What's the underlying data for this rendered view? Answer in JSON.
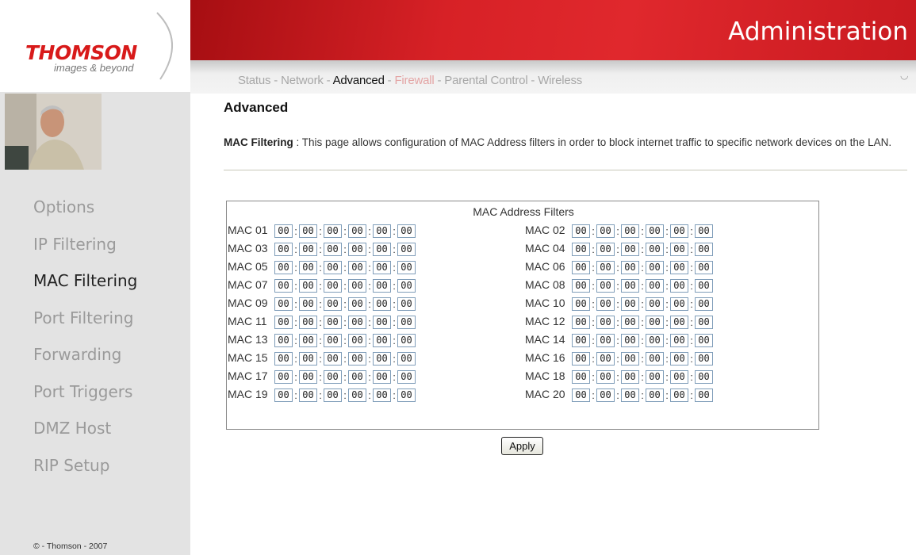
{
  "brand": {
    "name": "THOMSON",
    "tagline": "images & beyond"
  },
  "header": {
    "title": "Administration"
  },
  "topnav": [
    {
      "label": "Status",
      "state": "normal"
    },
    {
      "label": "Network",
      "state": "normal"
    },
    {
      "label": "Advanced",
      "state": "current"
    },
    {
      "label": "Firewall",
      "state": "highlight"
    },
    {
      "label": "Parental Control",
      "state": "normal"
    },
    {
      "label": "Wireless",
      "state": "normal"
    }
  ],
  "topnav_separator": " - ",
  "sidebar": {
    "items": [
      {
        "label": "Options",
        "active": false
      },
      {
        "label": "IP Filtering",
        "active": false
      },
      {
        "label": "MAC Filtering",
        "active": true
      },
      {
        "label": "Port Filtering",
        "active": false
      },
      {
        "label": "Forwarding",
        "active": false
      },
      {
        "label": "Port Triggers",
        "active": false
      },
      {
        "label": "DMZ Host",
        "active": false
      },
      {
        "label": "RIP Setup",
        "active": false
      }
    ],
    "copyright": "© - Thomson - 2007"
  },
  "main": {
    "title": "Advanced",
    "description_label": "MAC Filtering",
    "description_sep": " : ",
    "description": "This page allows configuration of MAC Address filters in order to block internet traffic to specific network devices on the LAN.",
    "filters_caption": "MAC Address Filters",
    "mac_entries": [
      {
        "label": "MAC 01",
        "octets": [
          "00",
          "00",
          "00",
          "00",
          "00",
          "00"
        ]
      },
      {
        "label": "MAC 02",
        "octets": [
          "00",
          "00",
          "00",
          "00",
          "00",
          "00"
        ]
      },
      {
        "label": "MAC 03",
        "octets": [
          "00",
          "00",
          "00",
          "00",
          "00",
          "00"
        ]
      },
      {
        "label": "MAC 04",
        "octets": [
          "00",
          "00",
          "00",
          "00",
          "00",
          "00"
        ]
      },
      {
        "label": "MAC 05",
        "octets": [
          "00",
          "00",
          "00",
          "00",
          "00",
          "00"
        ]
      },
      {
        "label": "MAC 06",
        "octets": [
          "00",
          "00",
          "00",
          "00",
          "00",
          "00"
        ]
      },
      {
        "label": "MAC 07",
        "octets": [
          "00",
          "00",
          "00",
          "00",
          "00",
          "00"
        ]
      },
      {
        "label": "MAC 08",
        "octets": [
          "00",
          "00",
          "00",
          "00",
          "00",
          "00"
        ]
      },
      {
        "label": "MAC 09",
        "octets": [
          "00",
          "00",
          "00",
          "00",
          "00",
          "00"
        ]
      },
      {
        "label": "MAC 10",
        "octets": [
          "00",
          "00",
          "00",
          "00",
          "00",
          "00"
        ]
      },
      {
        "label": "MAC 11",
        "octets": [
          "00",
          "00",
          "00",
          "00",
          "00",
          "00"
        ]
      },
      {
        "label": "MAC 12",
        "octets": [
          "00",
          "00",
          "00",
          "00",
          "00",
          "00"
        ]
      },
      {
        "label": "MAC 13",
        "octets": [
          "00",
          "00",
          "00",
          "00",
          "00",
          "00"
        ]
      },
      {
        "label": "MAC 14",
        "octets": [
          "00",
          "00",
          "00",
          "00",
          "00",
          "00"
        ]
      },
      {
        "label": "MAC 15",
        "octets": [
          "00",
          "00",
          "00",
          "00",
          "00",
          "00"
        ]
      },
      {
        "label": "MAC 16",
        "octets": [
          "00",
          "00",
          "00",
          "00",
          "00",
          "00"
        ]
      },
      {
        "label": "MAC 17",
        "octets": [
          "00",
          "00",
          "00",
          "00",
          "00",
          "00"
        ]
      },
      {
        "label": "MAC 18",
        "octets": [
          "00",
          "00",
          "00",
          "00",
          "00",
          "00"
        ]
      },
      {
        "label": "MAC 19",
        "octets": [
          "00",
          "00",
          "00",
          "00",
          "00",
          "00"
        ]
      },
      {
        "label": "MAC 20",
        "octets": [
          "00",
          "00",
          "00",
          "00",
          "00",
          "00"
        ]
      }
    ],
    "apply_label": "Apply"
  },
  "colors": {
    "brand_red": "#d81a1a",
    "banner_red": "#d72126",
    "nav_inactive": "#9a9a9a",
    "nav_active": "#222222",
    "firewall_link": "#e4a5a5"
  }
}
